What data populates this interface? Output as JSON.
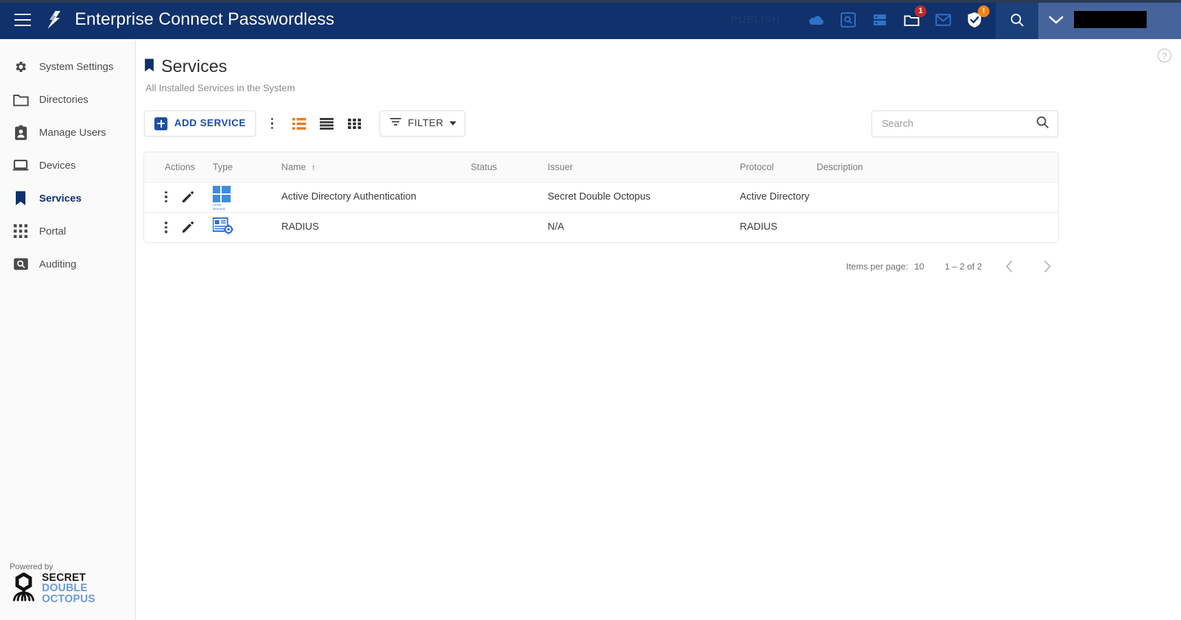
{
  "topbar": {
    "menu_icon": "hamburger-menu-icon",
    "logo_icon": "octopus-brand-icon",
    "title": "Enterprise Connect Passwordless",
    "publish_label": "PUBLISH",
    "icons": [
      {
        "name": "cloud-icon",
        "badge": null
      },
      {
        "name": "search-box-icon",
        "badge": null
      },
      {
        "name": "server-icon",
        "badge": null
      },
      {
        "name": "folder-icon",
        "badge": "1",
        "badge_color": "#c62828"
      },
      {
        "name": "mail-icon",
        "badge": null
      },
      {
        "name": "shield-check-icon",
        "badge": "!",
        "badge_color": "#ef8316"
      }
    ],
    "search_icon": "search-icon",
    "user_chevron_icon": "chevron-down-icon",
    "user_name_redacted": ""
  },
  "sidebar": {
    "items": [
      {
        "label": "System Settings",
        "icon": "gear-icon",
        "active": false
      },
      {
        "label": "Directories",
        "icon": "folder-icon",
        "active": false
      },
      {
        "label": "Manage Users",
        "icon": "id-badge-icon",
        "active": false
      },
      {
        "label": "Devices",
        "icon": "laptop-icon",
        "active": false
      },
      {
        "label": "Services",
        "icon": "bookmark-icon",
        "active": true
      },
      {
        "label": "Portal",
        "icon": "grid-dots-icon",
        "active": false
      },
      {
        "label": "Auditing",
        "icon": "audit-search-icon",
        "active": false
      }
    ],
    "footer": {
      "powered_by": "Powered by",
      "brand_line1": "SECRET",
      "brand_line2": "DOUBLE",
      "brand_line3": "OCTOPUS",
      "logo_icon": "octopus-logo-icon"
    }
  },
  "main": {
    "help_icon": "help-circle-icon",
    "page_icon": "bookmark-icon",
    "title": "Services",
    "subtitle": "All Installed Services in the System",
    "toolbar": {
      "add_label": "ADD SERVICE",
      "add_icon": "plus-square-icon",
      "kebab_icon": "more-vertical-icon",
      "view_list_icon": "list-view-icon",
      "view_rows_icon": "rows-view-icon",
      "view_grid_icon": "grid-view-icon",
      "filter_label": "FILTER",
      "filter_icon": "filter-icon",
      "filter_caret_icon": "chevron-down-icon"
    },
    "search": {
      "placeholder": "Search",
      "value": "",
      "icon": "search-icon"
    },
    "table": {
      "columns": [
        "Actions",
        "Type",
        "Name",
        "Status",
        "Issuer",
        "Protocol",
        "Description"
      ],
      "sort_column": "Name",
      "sort_direction": "asc",
      "sort_icon": "arrow-up-icon",
      "rows": [
        {
          "actions_kebab_icon": "more-vertical-icon",
          "actions_edit_icon": "pencil-icon",
          "type_icon": "active-directory-icon",
          "type_icon_caption_1": "Active",
          "type_icon_caption_2": "Directory",
          "name": "Active Directory Authentication",
          "status": "",
          "issuer": "Secret Double Octopus",
          "protocol": "Active Directory",
          "description": ""
        },
        {
          "actions_kebab_icon": "more-vertical-icon",
          "actions_edit_icon": "pencil-icon",
          "type_icon": "radius-server-icon",
          "type_icon_caption_1": "",
          "type_icon_caption_2": "",
          "name": "RADIUS",
          "status": "",
          "issuer": "N/A",
          "protocol": "RADIUS",
          "description": ""
        }
      ]
    },
    "paginator": {
      "items_per_page_label": "Items per page:",
      "items_per_page_value": "10",
      "range_label": "1 – 2 of 2",
      "prev_icon": "chevron-left-icon",
      "next_icon": "chevron-right-icon"
    }
  },
  "colors": {
    "header_bg": "#10316b",
    "accent_blue": "#1f4fa3",
    "orange": "#ef8316",
    "red_badge": "#c62828"
  }
}
